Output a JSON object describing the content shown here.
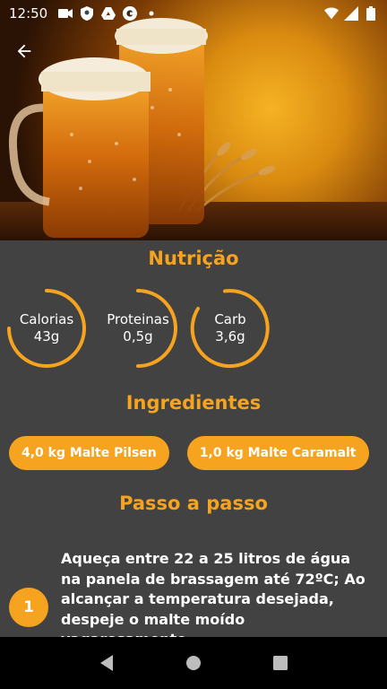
{
  "status_bar": {
    "time": "12:50",
    "left_icons": [
      "video-icon",
      "shield-icon",
      "drive-icon",
      "google-icon",
      "dot-icon"
    ],
    "right_icons": [
      "wifi-icon",
      "signal-icon",
      "battery-icon"
    ]
  },
  "header": {
    "image": "beer-mugs-photo",
    "back_icon": "arrow-back-icon"
  },
  "nutrition": {
    "title": "Nutrição",
    "items": [
      {
        "label": "Calorias",
        "value": "43g"
      },
      {
        "label": "Proteinas",
        "value": "0,5g"
      },
      {
        "label": "Carb",
        "value": "3,6g"
      }
    ]
  },
  "ingredients": {
    "title": "Ingredientes",
    "items": [
      "4,0 kg Malte Pilsen",
      "1,0 kg Malte Caramalt",
      ""
    ]
  },
  "steps": {
    "title": "Passo a passo",
    "items": [
      {
        "number": "1",
        "text": "Aqueça entre 22 a 25 litros de água na panela de brassagem até 72ºC; Ao alcançar a temperatura desejada, despeje o malte moído vagarosamente."
      }
    ]
  },
  "colors": {
    "accent": "#f6a31f",
    "background": "#424242",
    "nav_bar": "#000000",
    "text": "#ffffff"
  },
  "nav_bar": {
    "buttons": [
      "back-triangle-icon",
      "home-circle-icon",
      "recents-square-icon"
    ]
  }
}
